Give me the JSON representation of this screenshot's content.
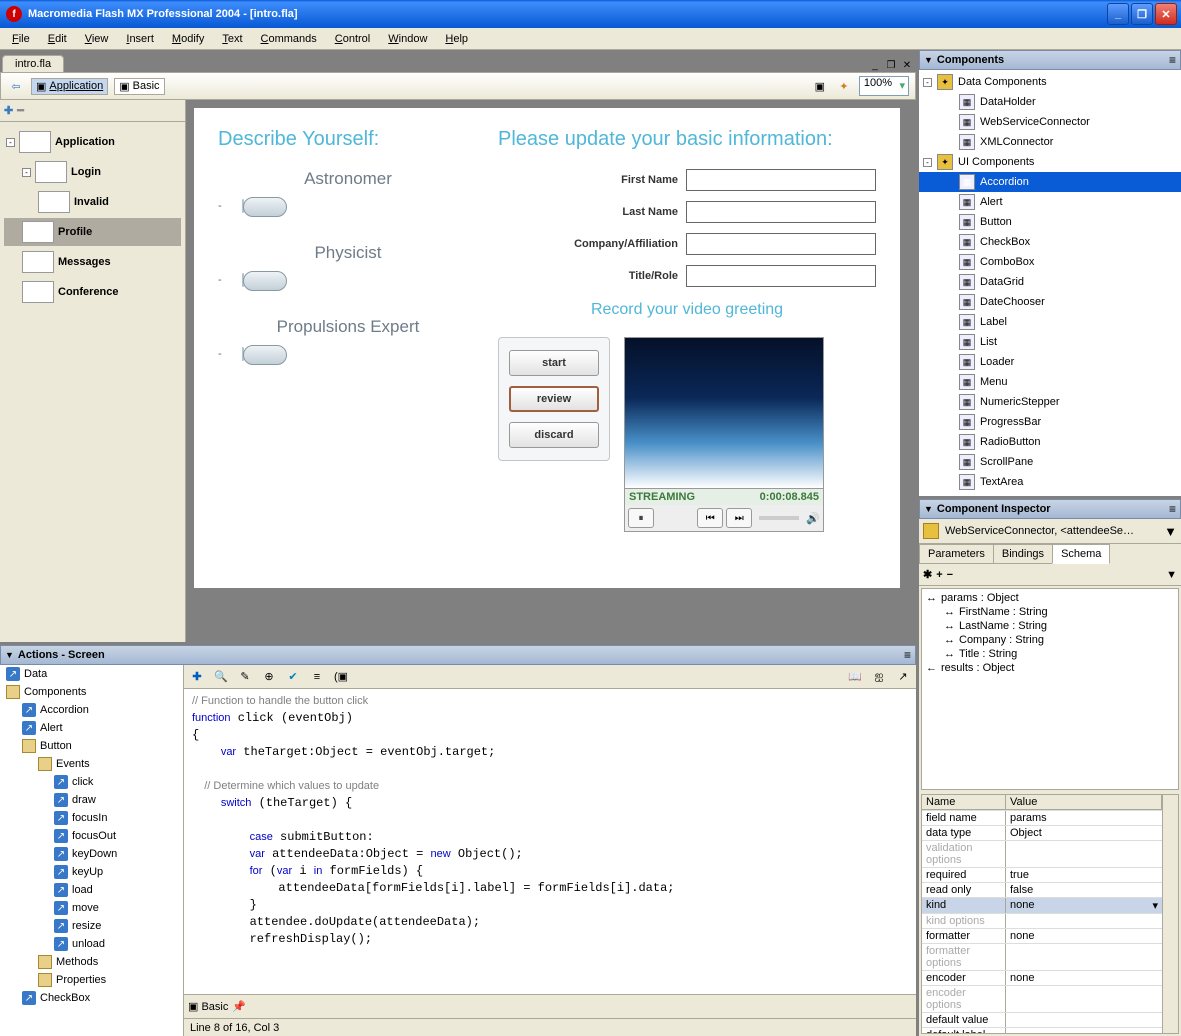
{
  "app": {
    "title": "Macromedia Flash MX Professional 2004  -  [intro.fla]"
  },
  "menus": [
    "File",
    "Edit",
    "View",
    "Insert",
    "Modify",
    "Text",
    "Commands",
    "Control",
    "Window",
    "Help"
  ],
  "doc": {
    "tab": "intro.fla",
    "breadcrumb1": "Application",
    "breadcrumb2": "Basic",
    "zoom": "100%"
  },
  "outline": {
    "items": [
      {
        "label": "Application",
        "indent": 0,
        "sel": false,
        "exp": "-"
      },
      {
        "label": "Login",
        "indent": 1,
        "sel": false,
        "exp": "-"
      },
      {
        "label": "Invalid",
        "indent": 2,
        "sel": false
      },
      {
        "label": "Profile",
        "indent": 1,
        "sel": true
      },
      {
        "label": "Messages",
        "indent": 1,
        "sel": false
      },
      {
        "label": "Conference",
        "indent": 1,
        "sel": false
      }
    ]
  },
  "stage": {
    "h_left": "Describe Yourself:",
    "h_right": "Please update your basic information:",
    "sliders": [
      "Astronomer",
      "Physicist",
      "Propulsions Expert"
    ],
    "form": [
      "First Name",
      "Last Name",
      "Company/Affiliation",
      "Title/Role"
    ],
    "video_title": "Record your video greeting",
    "vbtn_start": "start",
    "vbtn_review": "review",
    "vbtn_discard": "discard",
    "stream_label": "STREAMING",
    "stream_time": "0:00:08.845"
  },
  "actions": {
    "panel_title": "Actions - Screen",
    "tree": [
      {
        "label": "Data",
        "icon": "blue",
        "indent": 0
      },
      {
        "label": "Components",
        "icon": "book",
        "indent": 0
      },
      {
        "label": "Accordion",
        "icon": "blue",
        "indent": 1
      },
      {
        "label": "Alert",
        "icon": "blue",
        "indent": 1
      },
      {
        "label": "Button",
        "icon": "book",
        "indent": 1
      },
      {
        "label": "Events",
        "icon": "book",
        "indent": 2
      },
      {
        "label": "click",
        "icon": "blue",
        "indent": 3
      },
      {
        "label": "draw",
        "icon": "blue",
        "indent": 3
      },
      {
        "label": "focusIn",
        "icon": "blue",
        "indent": 3
      },
      {
        "label": "focusOut",
        "icon": "blue",
        "indent": 3
      },
      {
        "label": "keyDown",
        "icon": "blue",
        "indent": 3
      },
      {
        "label": "keyUp",
        "icon": "blue",
        "indent": 3
      },
      {
        "label": "load",
        "icon": "blue",
        "indent": 3
      },
      {
        "label": "move",
        "icon": "blue",
        "indent": 3
      },
      {
        "label": "resize",
        "icon": "blue",
        "indent": 3
      },
      {
        "label": "unload",
        "icon": "blue",
        "indent": 3
      },
      {
        "label": "Methods",
        "icon": "book",
        "indent": 2
      },
      {
        "label": "Properties",
        "icon": "book",
        "indent": 2
      },
      {
        "label": "CheckBox",
        "icon": "blue",
        "indent": 1
      }
    ],
    "code_lines": [
      {
        "t": "// Function to handle the button click",
        "cls": "cm"
      },
      {
        "t": "function click (eventObj)",
        "cls": "kw"
      },
      {
        "t": "{",
        "cls": ""
      },
      {
        "t": "    var theTarget:Object = eventObj.target;",
        "cls": "kw"
      },
      {
        "t": "",
        "cls": ""
      },
      {
        "t": "    // Determine which values to update",
        "cls": "cm"
      },
      {
        "t": "    switch (theTarget) {",
        "cls": "kw"
      },
      {
        "t": "",
        "cls": ""
      },
      {
        "t": "        case submitButton:",
        "cls": "kw"
      },
      {
        "t": "        var attendeeData:Object = new Object();",
        "cls": "kw"
      },
      {
        "t": "        for (var i in formFields) {",
        "cls": "kw"
      },
      {
        "t": "            attendeeData[formFields[i].label] = formFields[i].data;",
        "cls": ""
      },
      {
        "t": "        }",
        "cls": ""
      },
      {
        "t": "        attendee.doUpdate(attendeeData);",
        "cls": ""
      },
      {
        "t": "        refreshDisplay();",
        "cls": ""
      }
    ],
    "tab": "Basic",
    "status": "Line 8 of 16, Col 3"
  },
  "components": {
    "title": "Components",
    "groups": [
      {
        "label": "Data Components",
        "items": [
          "DataHolder",
          "WebServiceConnector",
          "XMLConnector"
        ]
      },
      {
        "label": "UI Components",
        "items": [
          "Accordion",
          "Alert",
          "Button",
          "CheckBox",
          "ComboBox",
          "DataGrid",
          "DateChooser",
          "Label",
          "List",
          "Loader",
          "Menu",
          "NumericStepper",
          "ProgressBar",
          "RadioButton",
          "ScrollPane",
          "TextArea"
        ]
      }
    ],
    "selected": "Accordion"
  },
  "inspector": {
    "title": "Component Inspector",
    "target": "WebServiceConnector, <attendeeSe…",
    "tabs": [
      "Parameters",
      "Bindings",
      "Schema"
    ],
    "active_tab": "Schema",
    "schema": [
      {
        "label": "params : Object",
        "indent": 0,
        "icon": "↔"
      },
      {
        "label": "FirstName : String",
        "indent": 1,
        "icon": "↔"
      },
      {
        "label": "LastName : String",
        "indent": 1,
        "icon": "↔"
      },
      {
        "label": "Company : String",
        "indent": 1,
        "icon": "↔"
      },
      {
        "label": "Title : String",
        "indent": 1,
        "icon": "↔"
      },
      {
        "label": "results : Object",
        "indent": 0,
        "icon": "←"
      }
    ],
    "props": [
      {
        "name": "field name",
        "value": "params",
        "dis": false
      },
      {
        "name": "data type",
        "value": "Object",
        "dis": false
      },
      {
        "name": "validation options",
        "value": "",
        "dis": true
      },
      {
        "name": "required",
        "value": "true",
        "dis": false
      },
      {
        "name": "read only",
        "value": "false",
        "dis": false
      },
      {
        "name": "kind",
        "value": "none",
        "dis": false,
        "sel": true
      },
      {
        "name": "kind options",
        "value": "",
        "dis": true
      },
      {
        "name": "formatter",
        "value": "none",
        "dis": false
      },
      {
        "name": "formatter options",
        "value": "",
        "dis": true
      },
      {
        "name": "encoder",
        "value": "none",
        "dis": false
      },
      {
        "name": "encoder options",
        "value": "",
        "dis": true
      },
      {
        "name": "default value",
        "value": "",
        "dis": false
      },
      {
        "name": "default label",
        "value": "",
        "dis": false
      }
    ],
    "prop_hdr_name": "Name",
    "prop_hdr_value": "Value"
  }
}
